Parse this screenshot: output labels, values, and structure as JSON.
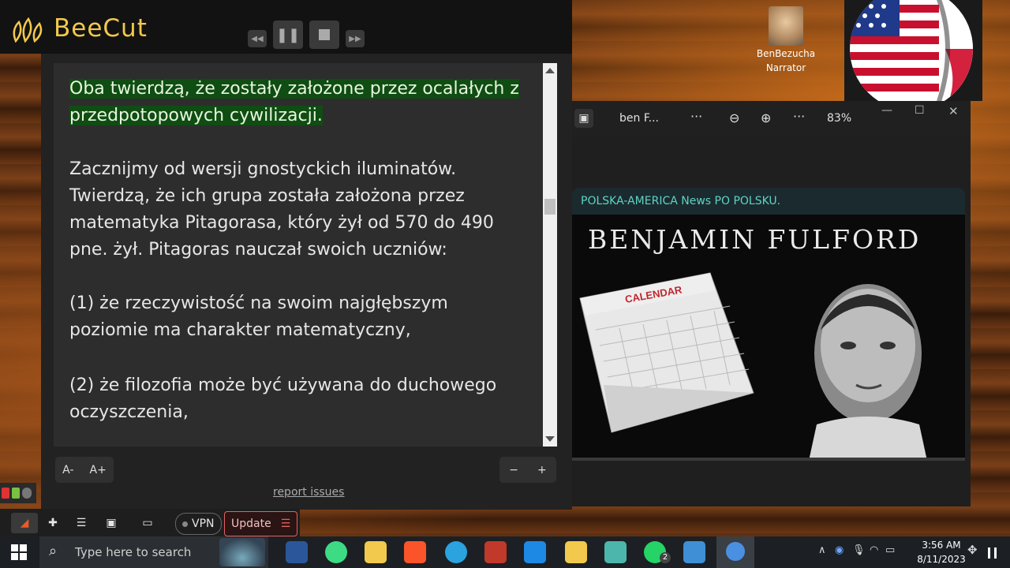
{
  "app": {
    "title": "BeeCut"
  },
  "reader": {
    "paragraphs": [
      {
        "lines": [
          "Oba twierdzą, że zostały założone przez ocalałych z",
          "przedpotopowych cywilizacji."
        ],
        "highlighted": true
      },
      {
        "lines": [
          "Zacznijmy od wersji gnostyckich iluminatów.",
          "Twierdzą, że ich grupa została założona przez",
          "matematyka Pitagorasa, który żył od 570 do 490",
          "pne. żył. Pitagoras nauczał swoich uczniów:"
        ],
        "highlighted": false
      },
      {
        "lines": [
          "(1) że rzeczywistość na swoim najgłębszym",
          "poziomie ma charakter matematyczny,"
        ],
        "highlighted": false
      },
      {
        "lines": [
          "(2) że filozofia może być używana do duchowego",
          "oczyszczenia,"
        ],
        "highlighted": false
      }
    ],
    "font_decrease": "A-",
    "font_increase": "A+",
    "minus": "−",
    "plus": "+",
    "report_link": "report issues"
  },
  "browser_strip": {
    "vpn": "VPN",
    "update": "Update"
  },
  "viewer": {
    "file_name": "ben F...",
    "more1": "···",
    "more2": "···",
    "zoom": "83%",
    "banner_header": "POLSKA-AMERICA News PO POLSKU.",
    "banner_name": "BENJAMIN FULFORD",
    "calendar_label": "CALENDAR"
  },
  "narrator": {
    "name": "BenBezucha",
    "role": "Narrator"
  },
  "taskbar": {
    "search_placeholder": "Type here to search",
    "time": "3:56 AM",
    "date": "8/11/2023",
    "whatsapp_badge": "2"
  },
  "colors": {
    "accent_gold": "#f2c94c",
    "highlight_green": "#0f4d12",
    "banner_teal": "#5fd3c6"
  }
}
